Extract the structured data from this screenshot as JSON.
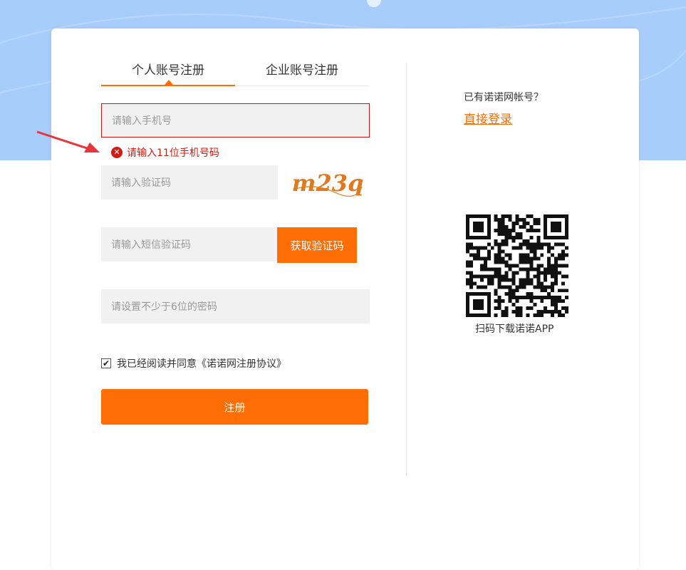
{
  "tabs": [
    {
      "label": "个人账号注册",
      "active": true
    },
    {
      "label": "企业账号注册",
      "active": false
    }
  ],
  "form": {
    "phone_placeholder": "请输入手机号",
    "phone_error": "请输入11位手机号码",
    "captcha_placeholder": "请输入验证码",
    "captcha_text": "m23q",
    "sms_placeholder": "请输入短信验证码",
    "sms_button": "获取验证码",
    "password_placeholder": "请设置不少于6位的密码",
    "agree_text": "我已经阅读并同意《诺诺网注册协议》",
    "agree_checked": true,
    "submit_label": "注册"
  },
  "side": {
    "has_account": "已有诺诺网帐号？",
    "login_link": "直接登录",
    "qr_caption": "扫码下载诺诺APP"
  },
  "colors": {
    "accent": "#ff6d05",
    "error": "#d01b12",
    "banner": "#a9cdfb"
  }
}
